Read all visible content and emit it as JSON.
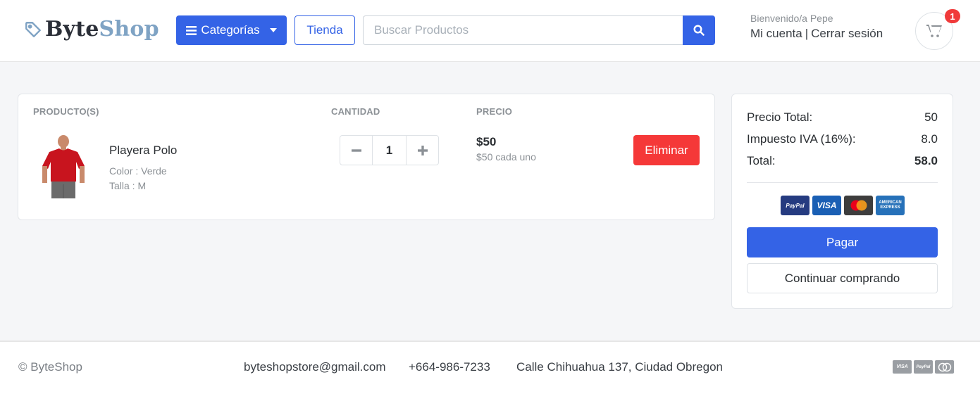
{
  "header": {
    "logo": {
      "part1": "Byte",
      "part2": "Shop",
      "icon": "tag-icon"
    },
    "categories_label": "Categorías",
    "store_label": "Tienda",
    "search": {
      "placeholder": "Buscar Productos",
      "value": "",
      "icon": "search-icon"
    },
    "welcome": "Bienvenido/a Pepe",
    "account_link": "Mi cuenta",
    "separator": "|",
    "logout_link": "Cerrar sesión",
    "cart": {
      "icon": "cart-icon",
      "count": "1"
    }
  },
  "cart": {
    "columns": {
      "product": "PRODUCTO(S)",
      "quantity": "CANTIDAD",
      "price": "PRECIO"
    },
    "items": [
      {
        "name": "Playera Polo",
        "color": "Color : Verde",
        "size": "Talla : M",
        "quantity": "1",
        "price": "$50",
        "price_each": "$50 cada uno",
        "remove_label": "Eliminar"
      }
    ]
  },
  "summary": {
    "subtotal_label": "Precio Total:",
    "subtotal_value": "50",
    "tax_label": "Impuesto IVA (16%):",
    "tax_value": "8.0",
    "total_label": "Total:",
    "total_value": "58.0",
    "payment_cards": [
      "PayPal",
      "VISA",
      "Mastercard",
      "AMERICAN EXPRESS"
    ],
    "pay_label": "Pagar",
    "continue_label": "Continuar comprando"
  },
  "footer": {
    "copyright": "© ByteShop",
    "email": "byteshopstore@gmail.com",
    "phone": "+664-986-7233",
    "address": "Calle Chihuahua 137, Ciudad Obregon",
    "cards": [
      "VISA",
      "PayPal",
      "Mastercard"
    ]
  },
  "colors": {
    "primary": "#3463e6",
    "danger": "#f53838",
    "badge": "#f03a3a",
    "background": "#f5f6f8"
  }
}
